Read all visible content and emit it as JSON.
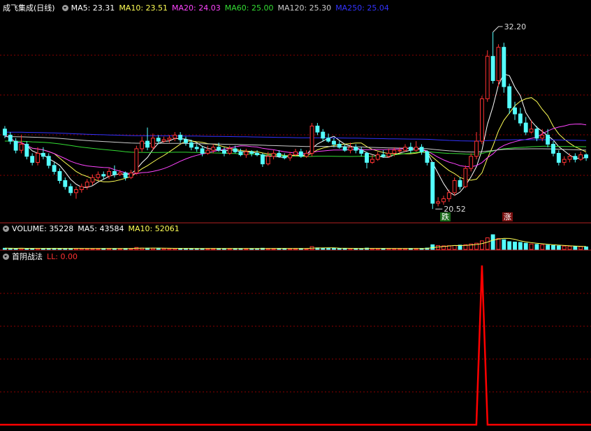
{
  "panels": {
    "main": {
      "title": "成飞集成(日线)",
      "ma": [
        {
          "label": "MA5: 23.31",
          "color": "#ffffff"
        },
        {
          "label": "MA10: 23.51",
          "color": "#ffff55"
        },
        {
          "label": "MA20: 24.03",
          "color": "#ff44ff"
        },
        {
          "label": "MA60: 25.00",
          "color": "#33dd33"
        },
        {
          "label": "MA120: 25.30",
          "color": "#cccccc"
        },
        {
          "label": "MA250: 25.04",
          "color": "#3333ff"
        }
      ],
      "high_label": "32.20",
      "low_label": "20.52",
      "sig_fall": "跌",
      "sig_rise": "涨"
    },
    "volume": {
      "items": [
        {
          "label": "VOLUME: 35228",
          "color": "#ffffff"
        },
        {
          "label": "MA5: 43584",
          "color": "#ffffff"
        },
        {
          "label": "MA10: 52061",
          "color": "#ffff55"
        }
      ]
    },
    "indicator": {
      "title": "首阴战法",
      "ll": "LL: 0.00"
    }
  },
  "colors": {
    "up": "#ff3232",
    "down": "#54ffff",
    "grid": "#8b0000",
    "indicator_line": "#ff0000"
  },
  "chart_data": {
    "type": "candlestick",
    "price_range": [
      19.7,
      33.4
    ],
    "candles": [
      [
        25.8,
        25.4,
        26.0,
        25.2
      ],
      [
        25.4,
        25.0,
        25.6,
        24.8
      ],
      [
        25.0,
        24.4,
        25.2,
        24.2
      ],
      [
        24.4,
        24.8,
        25.4,
        24.2
      ],
      [
        24.8,
        24.0,
        25.0,
        23.8
      ],
      [
        24.0,
        23.6,
        24.2,
        23.4
      ],
      [
        23.6,
        24.2,
        24.6,
        23.4
      ],
      [
        24.2,
        24.0,
        24.6,
        23.8
      ],
      [
        24.0,
        23.4,
        24.2,
        23.2
      ],
      [
        23.4,
        23.0,
        23.6,
        22.8
      ],
      [
        23.0,
        22.4,
        23.2,
        22.2
      ],
      [
        22.4,
        22.0,
        22.6,
        21.8
      ],
      [
        22.0,
        21.6,
        22.2,
        21.4
      ],
      [
        21.6,
        21.8,
        22.0,
        21.2
      ],
      [
        21.8,
        22.0,
        22.2,
        21.6
      ],
      [
        22.0,
        22.3,
        22.5,
        21.8
      ],
      [
        22.3,
        22.6,
        22.8,
        22.1
      ],
      [
        22.6,
        22.8,
        23.0,
        22.4
      ],
      [
        22.8,
        22.7,
        23.0,
        22.5
      ],
      [
        22.7,
        23.0,
        23.2,
        22.5
      ],
      [
        23.0,
        22.8,
        23.4,
        22.6
      ],
      [
        22.8,
        22.9,
        23.1,
        22.7
      ],
      [
        22.9,
        22.6,
        23.0,
        22.4
      ],
      [
        22.6,
        22.9,
        23.1,
        22.5
      ],
      [
        22.9,
        24.5,
        24.7,
        22.8
      ],
      [
        24.5,
        25.0,
        25.3,
        24.3
      ],
      [
        25.0,
        24.6,
        25.9,
        24.4
      ],
      [
        24.6,
        25.2,
        25.5,
        24.4
      ],
      [
        25.2,
        25.0,
        25.4,
        24.8
      ],
      [
        25.0,
        25.1,
        25.3,
        24.9
      ],
      [
        25.1,
        25.2,
        25.4,
        24.9
      ],
      [
        25.2,
        25.4,
        25.6,
        25.0
      ],
      [
        25.4,
        25.1,
        25.6,
        24.9
      ],
      [
        25.1,
        24.9,
        25.3,
        24.7
      ],
      [
        24.9,
        24.6,
        25.1,
        24.4
      ],
      [
        24.6,
        24.5,
        24.8,
        24.3
      ],
      [
        24.5,
        24.2,
        24.7,
        24.0
      ],
      [
        24.2,
        24.4,
        24.7,
        24.1
      ],
      [
        24.4,
        24.6,
        24.8,
        24.2
      ],
      [
        24.6,
        24.4,
        24.9,
        24.3
      ],
      [
        24.4,
        24.2,
        24.6,
        24.0
      ],
      [
        24.2,
        24.5,
        24.7,
        24.1
      ],
      [
        24.5,
        24.3,
        24.7,
        24.2
      ],
      [
        24.3,
        24.1,
        24.5,
        24.0
      ],
      [
        24.1,
        24.3,
        24.5,
        23.9
      ],
      [
        24.3,
        24.2,
        24.4,
        24.0
      ],
      [
        24.2,
        24.1,
        24.4,
        24.0
      ],
      [
        24.1,
        23.5,
        24.2,
        23.3
      ],
      [
        23.5,
        24.0,
        24.3,
        23.4
      ],
      [
        24.0,
        24.2,
        24.4,
        23.8
      ],
      [
        24.2,
        24.0,
        24.4,
        23.9
      ],
      [
        24.0,
        23.9,
        24.2,
        23.8
      ],
      [
        23.9,
        24.1,
        24.3,
        23.7
      ],
      [
        24.1,
        24.3,
        24.5,
        24.0
      ],
      [
        24.3,
        24.0,
        24.5,
        23.9
      ],
      [
        24.0,
        24.2,
        24.4,
        23.9
      ],
      [
        24.2,
        26.0,
        26.2,
        24.0
      ],
      [
        26.0,
        25.6,
        26.2,
        25.4
      ],
      [
        25.6,
        25.2,
        25.8,
        25.0
      ],
      [
        25.2,
        25.0,
        25.5,
        24.9
      ],
      [
        25.0,
        24.8,
        25.2,
        24.6
      ],
      [
        24.8,
        24.6,
        25.0,
        24.5
      ],
      [
        24.6,
        24.4,
        24.8,
        24.3
      ],
      [
        24.4,
        24.6,
        24.9,
        24.2
      ],
      [
        24.6,
        24.4,
        24.8,
        24.2
      ],
      [
        24.4,
        24.2,
        24.6,
        24.0
      ],
      [
        24.2,
        23.6,
        24.3,
        23.2
      ],
      [
        23.6,
        23.8,
        24.1,
        23.5
      ],
      [
        23.8,
        24.1,
        24.3,
        23.7
      ],
      [
        24.1,
        24.0,
        24.4,
        23.9
      ],
      [
        24.0,
        24.2,
        24.5,
        23.9
      ],
      [
        24.2,
        24.4,
        24.6,
        24.0
      ],
      [
        24.4,
        24.4,
        24.6,
        24.2
      ],
      [
        24.4,
        24.6,
        24.8,
        24.3
      ],
      [
        24.6,
        24.4,
        24.9,
        24.2
      ],
      [
        24.4,
        24.6,
        25.0,
        24.3
      ],
      [
        24.6,
        24.3,
        24.8,
        24.1
      ],
      [
        24.3,
        23.6,
        24.4,
        23.4
      ],
      [
        23.6,
        20.9,
        21.4,
        20.52
      ],
      [
        20.9,
        21.0,
        21.3,
        20.7
      ],
      [
        21.0,
        21.2,
        21.4,
        20.8
      ],
      [
        21.2,
        21.6,
        21.8,
        21.0
      ],
      [
        21.6,
        22.4,
        22.6,
        21.4
      ],
      [
        22.4,
        22.0,
        22.6,
        21.8
      ],
      [
        22.0,
        23.2,
        23.4,
        21.9
      ],
      [
        23.2,
        24.0,
        24.2,
        23.0
      ],
      [
        24.0,
        25.0,
        25.6,
        23.8
      ],
      [
        25.0,
        27.8,
        28.0,
        24.8
      ],
      [
        27.8,
        30.6,
        31.0,
        27.6
      ],
      [
        30.6,
        29.0,
        32.2,
        28.8
      ],
      [
        29.0,
        31.2,
        31.4,
        28.6
      ],
      [
        31.2,
        28.6,
        31.5,
        28.2
      ],
      [
        28.6,
        27.2,
        28.8,
        26.8
      ],
      [
        27.2,
        26.8,
        27.6,
        26.4
      ],
      [
        26.8,
        26.2,
        27.2,
        26.0
      ],
      [
        26.2,
        25.6,
        26.6,
        25.4
      ],
      [
        25.6,
        25.8,
        26.4,
        25.5
      ],
      [
        25.8,
        25.2,
        26.0,
        25.0
      ],
      [
        25.2,
        25.4,
        25.8,
        25.0
      ],
      [
        25.4,
        24.8,
        25.8,
        24.6
      ],
      [
        24.8,
        24.2,
        25.0,
        24.0
      ],
      [
        24.2,
        23.6,
        24.4,
        23.4
      ],
      [
        23.6,
        23.8,
        24.0,
        23.4
      ],
      [
        23.8,
        24.0,
        24.2,
        23.6
      ],
      [
        24.0,
        23.8,
        24.2,
        23.6
      ],
      [
        23.8,
        24.1,
        24.3,
        23.7
      ],
      [
        24.1,
        23.9,
        24.2,
        23.7
      ]
    ],
    "moving_averages": [
      "MA5",
      "MA10",
      "MA20",
      "MA60",
      "MA120",
      "MA250"
    ],
    "volume": [
      3,
      2.8,
      2.6,
      2.9,
      2.5,
      2.4,
      2.6,
      2.5,
      2.7,
      2.8,
      2.6,
      2.4,
      2.3,
      2.5,
      2.6,
      2.4,
      2.3,
      2.2,
      2.4,
      2.5,
      2.3,
      2.2,
      2.4,
      2.3,
      5,
      3.5,
      3.2,
      3,
      2.8,
      2.6,
      2.5,
      2.4,
      2.6,
      2.5,
      2.4,
      2.3,
      2.2,
      2.4,
      2.5,
      2.3,
      2.2,
      2.4,
      2.3,
      2.2,
      2.3,
      2.2,
      2.1,
      3,
      2.5,
      2.4,
      2.3,
      2.2,
      2.3,
      2.4,
      2.3,
      2.2,
      7,
      4,
      3.5,
      3,
      2.8,
      2.6,
      2.5,
      2.4,
      2.3,
      2.2,
      3.4,
      2.5,
      2.4,
      2.3,
      2.4,
      2.5,
      2.4,
      2.3,
      2.4,
      2.5,
      2.4,
      3.5,
      12,
      10,
      9,
      9.5,
      10,
      11,
      12,
      14,
      16,
      22,
      30,
      38,
      28,
      25,
      20,
      19,
      18,
      16,
      14,
      13,
      12,
      11,
      10,
      9,
      8.5,
      8,
      7.5,
      7,
      6.5
    ],
    "indicator": {
      "name": "LL",
      "spike_index": 87,
      "value_range": [
        0,
        1
      ]
    }
  }
}
